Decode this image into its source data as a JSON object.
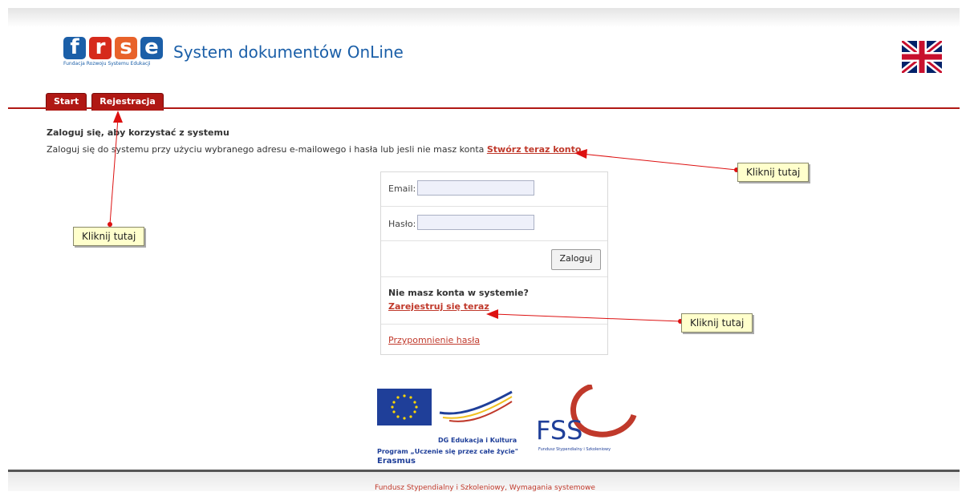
{
  "header": {
    "logo_letters": [
      "f",
      "r",
      "s",
      "e"
    ],
    "logo_tagline": "Fundacja Rozwoju Systemu Edukacji",
    "app_title": "System dokumentów OnLine",
    "language_flag_icon": "uk-flag-icon"
  },
  "tabs": [
    {
      "label": "Start"
    },
    {
      "label": "Rejestracja"
    }
  ],
  "intro": {
    "heading": "Zaloguj się, aby korzystać z systemu",
    "text": "Zaloguj się do systemu przy użyciu wybranego adresu e-mailowego i hasła lub jesli nie masz konta ",
    "create_account_link": "Stwórz teraz konto"
  },
  "login_form": {
    "email_label": "Email:",
    "email_value": "",
    "password_label": "Hasło:",
    "password_value": "",
    "submit_label": "Zaloguj",
    "no_account_text": "Nie masz konta w systemie?",
    "register_link": "Zarejestruj się teraz",
    "password_reminder_link": "Przypomnienie hasła"
  },
  "callouts": [
    {
      "label": "Kliknij tutaj"
    },
    {
      "label": "Kliknij tutaj"
    },
    {
      "label": "Kliknij tutaj"
    }
  ],
  "partners": {
    "eu_line1": "DG Edukacja i Kultura",
    "eu_line2": "Program „Uczenie się przez całe życie\"",
    "eu_line3": "Erasmus",
    "fss_logo": "FSS",
    "fss_caption": "Fundusz Stypendialny i Szkoleniowy"
  },
  "footer": {
    "text": "Fundusz Stypendialny i Szkoleniowy, Wymagania systemowe"
  },
  "colors": {
    "accent_red": "#b01814",
    "link_red": "#c0392b",
    "brand_blue": "#1b5fa8",
    "callout_bg": "#ffffcc"
  }
}
